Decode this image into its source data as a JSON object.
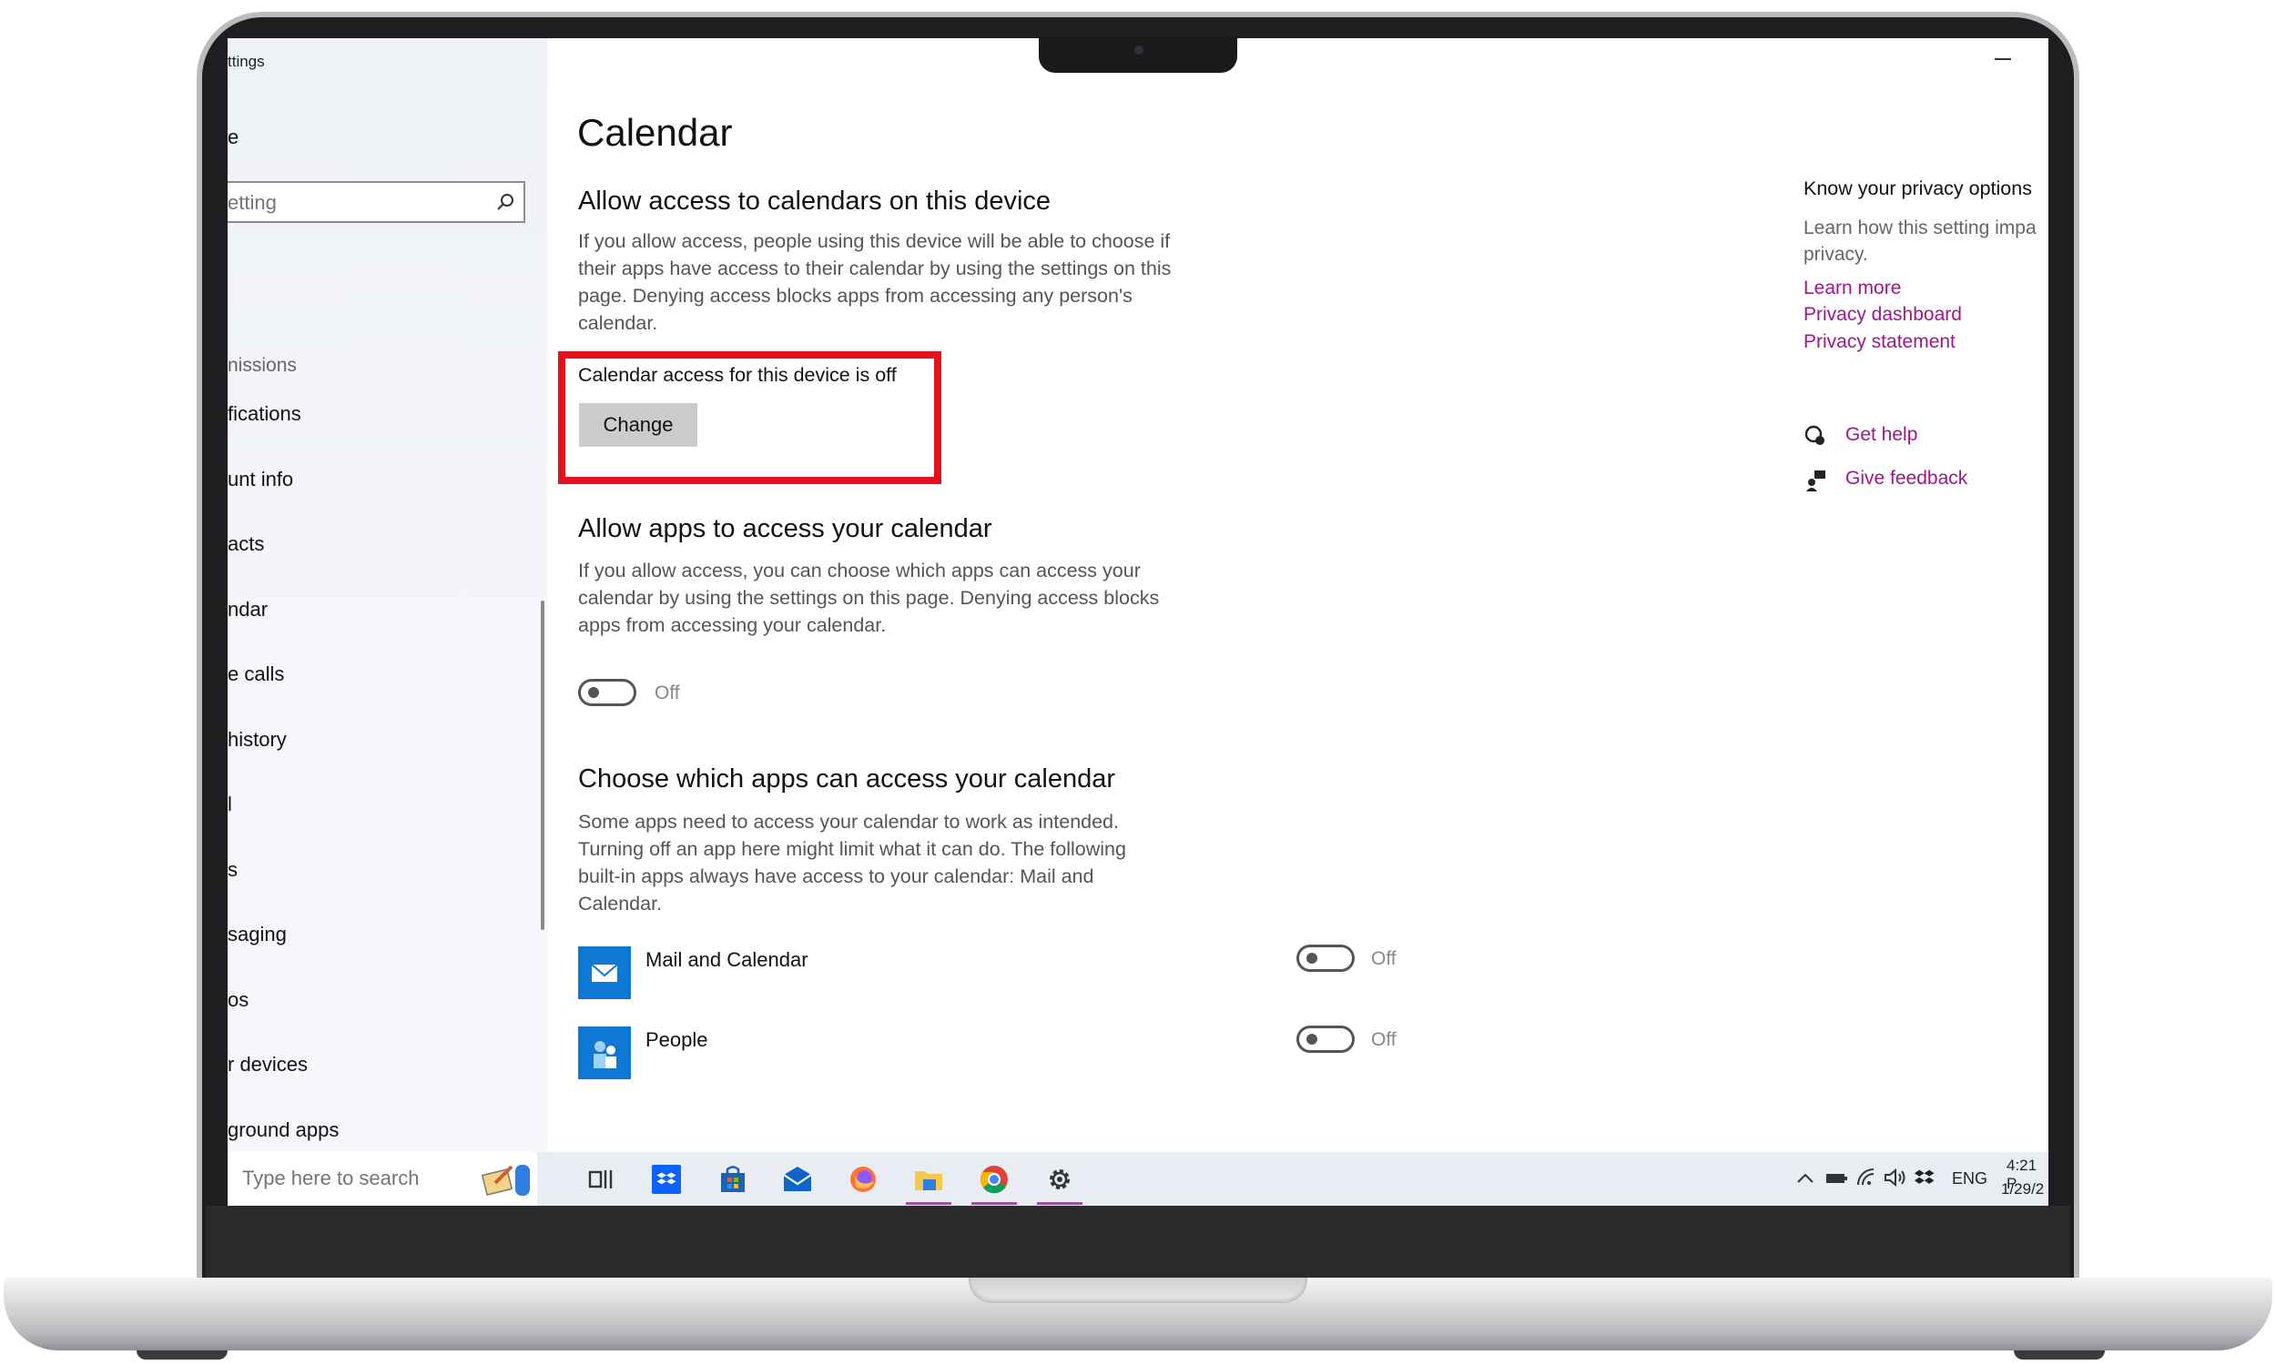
{
  "window": {
    "app_title": "ttings",
    "minimize_label": "—"
  },
  "sidebar": {
    "home_label": "e",
    "search_placeholder": "etting",
    "section_label": "nissions",
    "items": [
      {
        "label": "fications"
      },
      {
        "label": "unt info"
      },
      {
        "label": "acts"
      },
      {
        "label": "ndar"
      },
      {
        "label": "e calls"
      },
      {
        "label": "history"
      },
      {
        "label": "l"
      },
      {
        "label": "s"
      },
      {
        "label": "saging"
      },
      {
        "label": "os"
      },
      {
        "label": "r devices"
      },
      {
        "label": "ground apps"
      }
    ]
  },
  "main": {
    "title": "Calendar",
    "device_section": {
      "heading": "Allow access to calendars on this device",
      "description": "If you allow access, people using this device will be able to choose if their apps have access to their calendar by using the settings on this page. Denying access blocks apps from accessing any person's calendar.",
      "status": "Calendar access for this device is off",
      "button_label": "Change"
    },
    "apps_section": {
      "heading": "Allow apps to access your calendar",
      "description": "If you allow access, you can choose which apps can access your calendar by using the settings on this page. Denying access blocks apps from accessing your calendar.",
      "toggle_state": "Off"
    },
    "choose_section": {
      "heading": "Choose which apps can access your calendar",
      "description": "Some apps need to access your calendar to work as intended. Turning off an app here might limit what it can do. The following built-in apps always have access to your calendar: Mail and Calendar.",
      "apps": [
        {
          "name": "Mail and Calendar",
          "state": "Off"
        },
        {
          "name": "People",
          "state": "Off"
        }
      ]
    }
  },
  "right_panel": {
    "title": "Know your privacy options",
    "text": "Learn how this setting impa privacy.",
    "links": [
      "Learn more",
      "Privacy dashboard",
      "Privacy statement"
    ],
    "get_help": "Get help",
    "give_feedback": "Give feedback"
  },
  "taskbar": {
    "search_placeholder": "Type here to search",
    "language": "ENG",
    "time": "4:21 P",
    "date": "1/29/2"
  },
  "colors": {
    "accent_link": "#a1158f",
    "highlight_border": "#e5101b",
    "app_tile": "#0f78d4"
  }
}
